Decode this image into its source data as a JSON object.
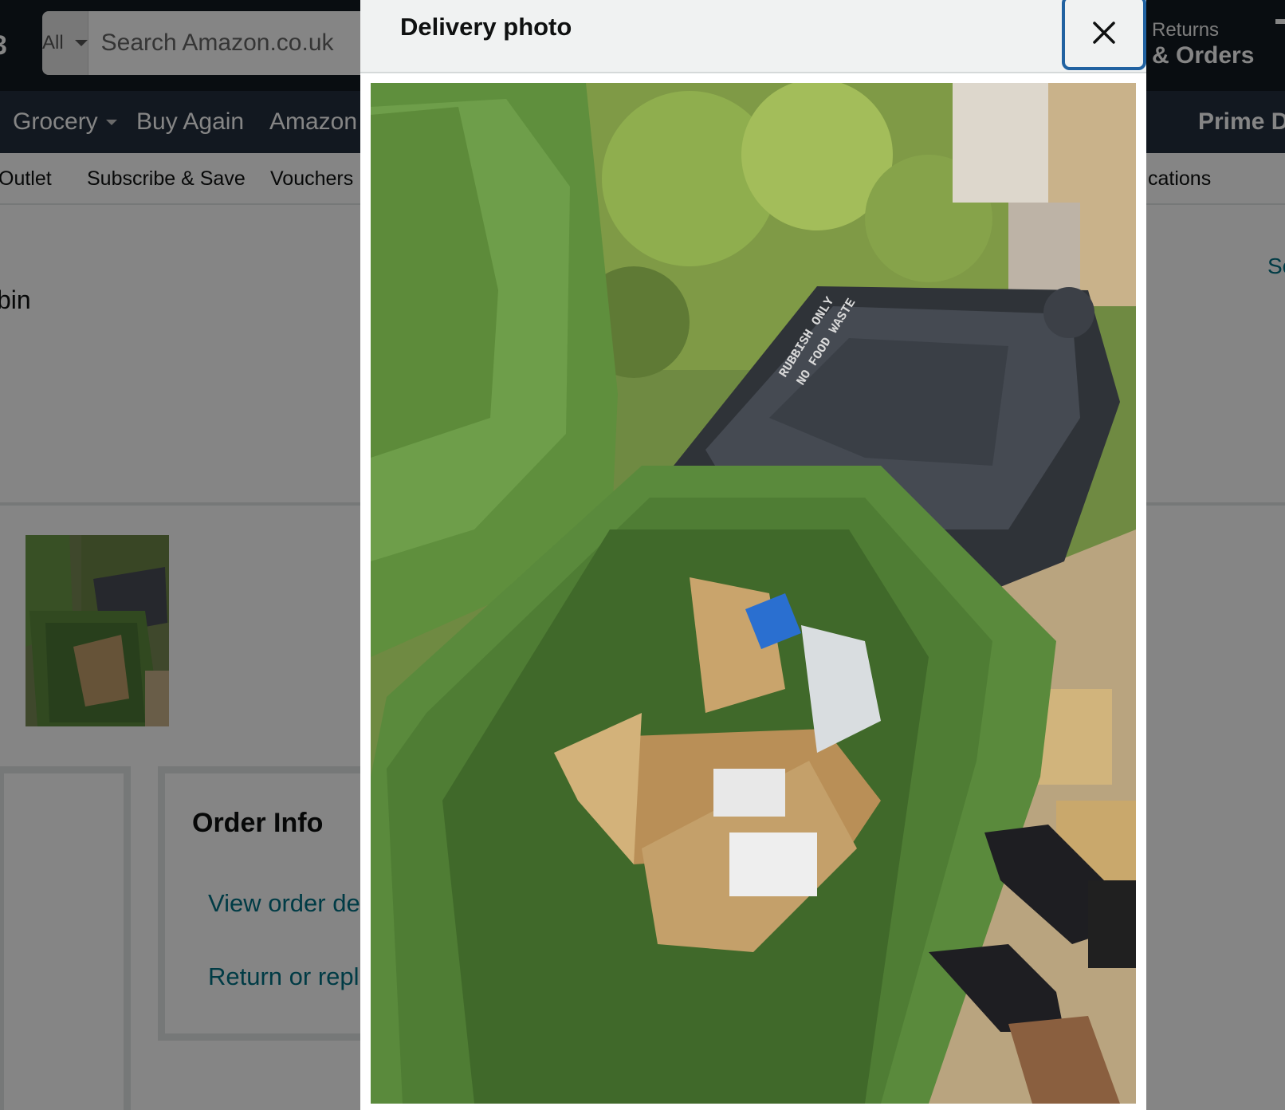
{
  "header": {
    "search_category": "All",
    "search_placeholder": "Search Amazon.co.uk",
    "returns_line1": "Returns",
    "returns_line2": "& Orders"
  },
  "nav": {
    "items": [
      "Grocery",
      "Buy Again",
      "Amazon"
    ],
    "prime_day": "Prime Da"
  },
  "subnav": {
    "items": [
      "Outlet",
      "Subscribe & Save",
      "Vouchers",
      "cations"
    ]
  },
  "content": {
    "title_fragment": "bin",
    "see_link_fragment": "Se"
  },
  "order_info": {
    "title": "Order Info",
    "links": [
      "View order de",
      "Return or repl"
    ]
  },
  "modal": {
    "title": "Delivery photo",
    "close_icon": "close-icon",
    "photo_caption": "RUBBISH ONLY NO FOOD WASTE"
  },
  "colors": {
    "topbar": "#131921",
    "navbar": "#232f3e",
    "link": "#007185",
    "close_focus": "#2162a1"
  }
}
